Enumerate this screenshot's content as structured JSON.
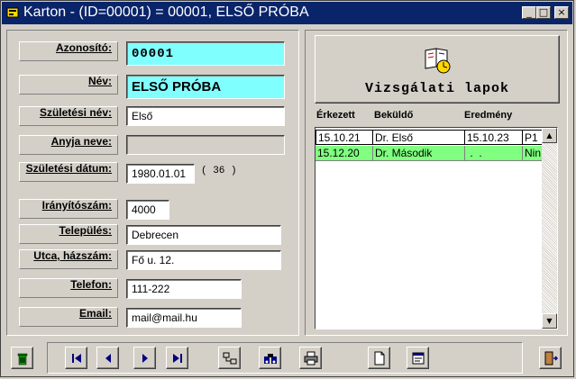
{
  "window": {
    "title": "Karton - (ID=00001) = 00001, ELSŐ PRÓBA",
    "minimize": "_",
    "maximize": "□",
    "close": "×"
  },
  "form": {
    "azonosito": {
      "label": "Azonosító:",
      "value": "00001"
    },
    "nev": {
      "label": "Név:",
      "value": "ELSŐ PRÓBA"
    },
    "szuletesi_nev": {
      "label": "Születési név:",
      "value": "Első"
    },
    "anyja_neve": {
      "label": "Anyja neve:",
      "value": ""
    },
    "szuletesi_datum": {
      "label": "Születési dátum:",
      "value": "1980.01.01",
      "age": "( 36 )"
    },
    "iranyitoszam": {
      "label": "Irányítószám:",
      "value": "4000"
    },
    "telepules": {
      "label": "Település:",
      "value": "Debrecen"
    },
    "utca": {
      "label": "Utca, házszám:",
      "value": "Fő u. 12."
    },
    "telefon": {
      "label": "Telefon:",
      "value": "111-222"
    },
    "email": {
      "label": "Email:",
      "value": "mail@mail.hu"
    }
  },
  "vizsgalati": {
    "button_label": "Vizsgálati lapok",
    "columns": [
      "Érkezett",
      "Beküldő",
      "Eredmény"
    ],
    "rows": [
      {
        "erkezett": "15.10.21",
        "bekuldo": "Dr. Első",
        "eredmeny": "15.10.23",
        "extra": "P1"
      },
      {
        "erkezett": "15.12.20",
        "bekuldo": "Dr. Második",
        "eredmeny": " .  .",
        "extra": "Nin"
      }
    ]
  },
  "colors": {
    "cyan_field": "#80ffff",
    "row_highlight": "#80ff80",
    "titlebar": "#0a246a"
  }
}
